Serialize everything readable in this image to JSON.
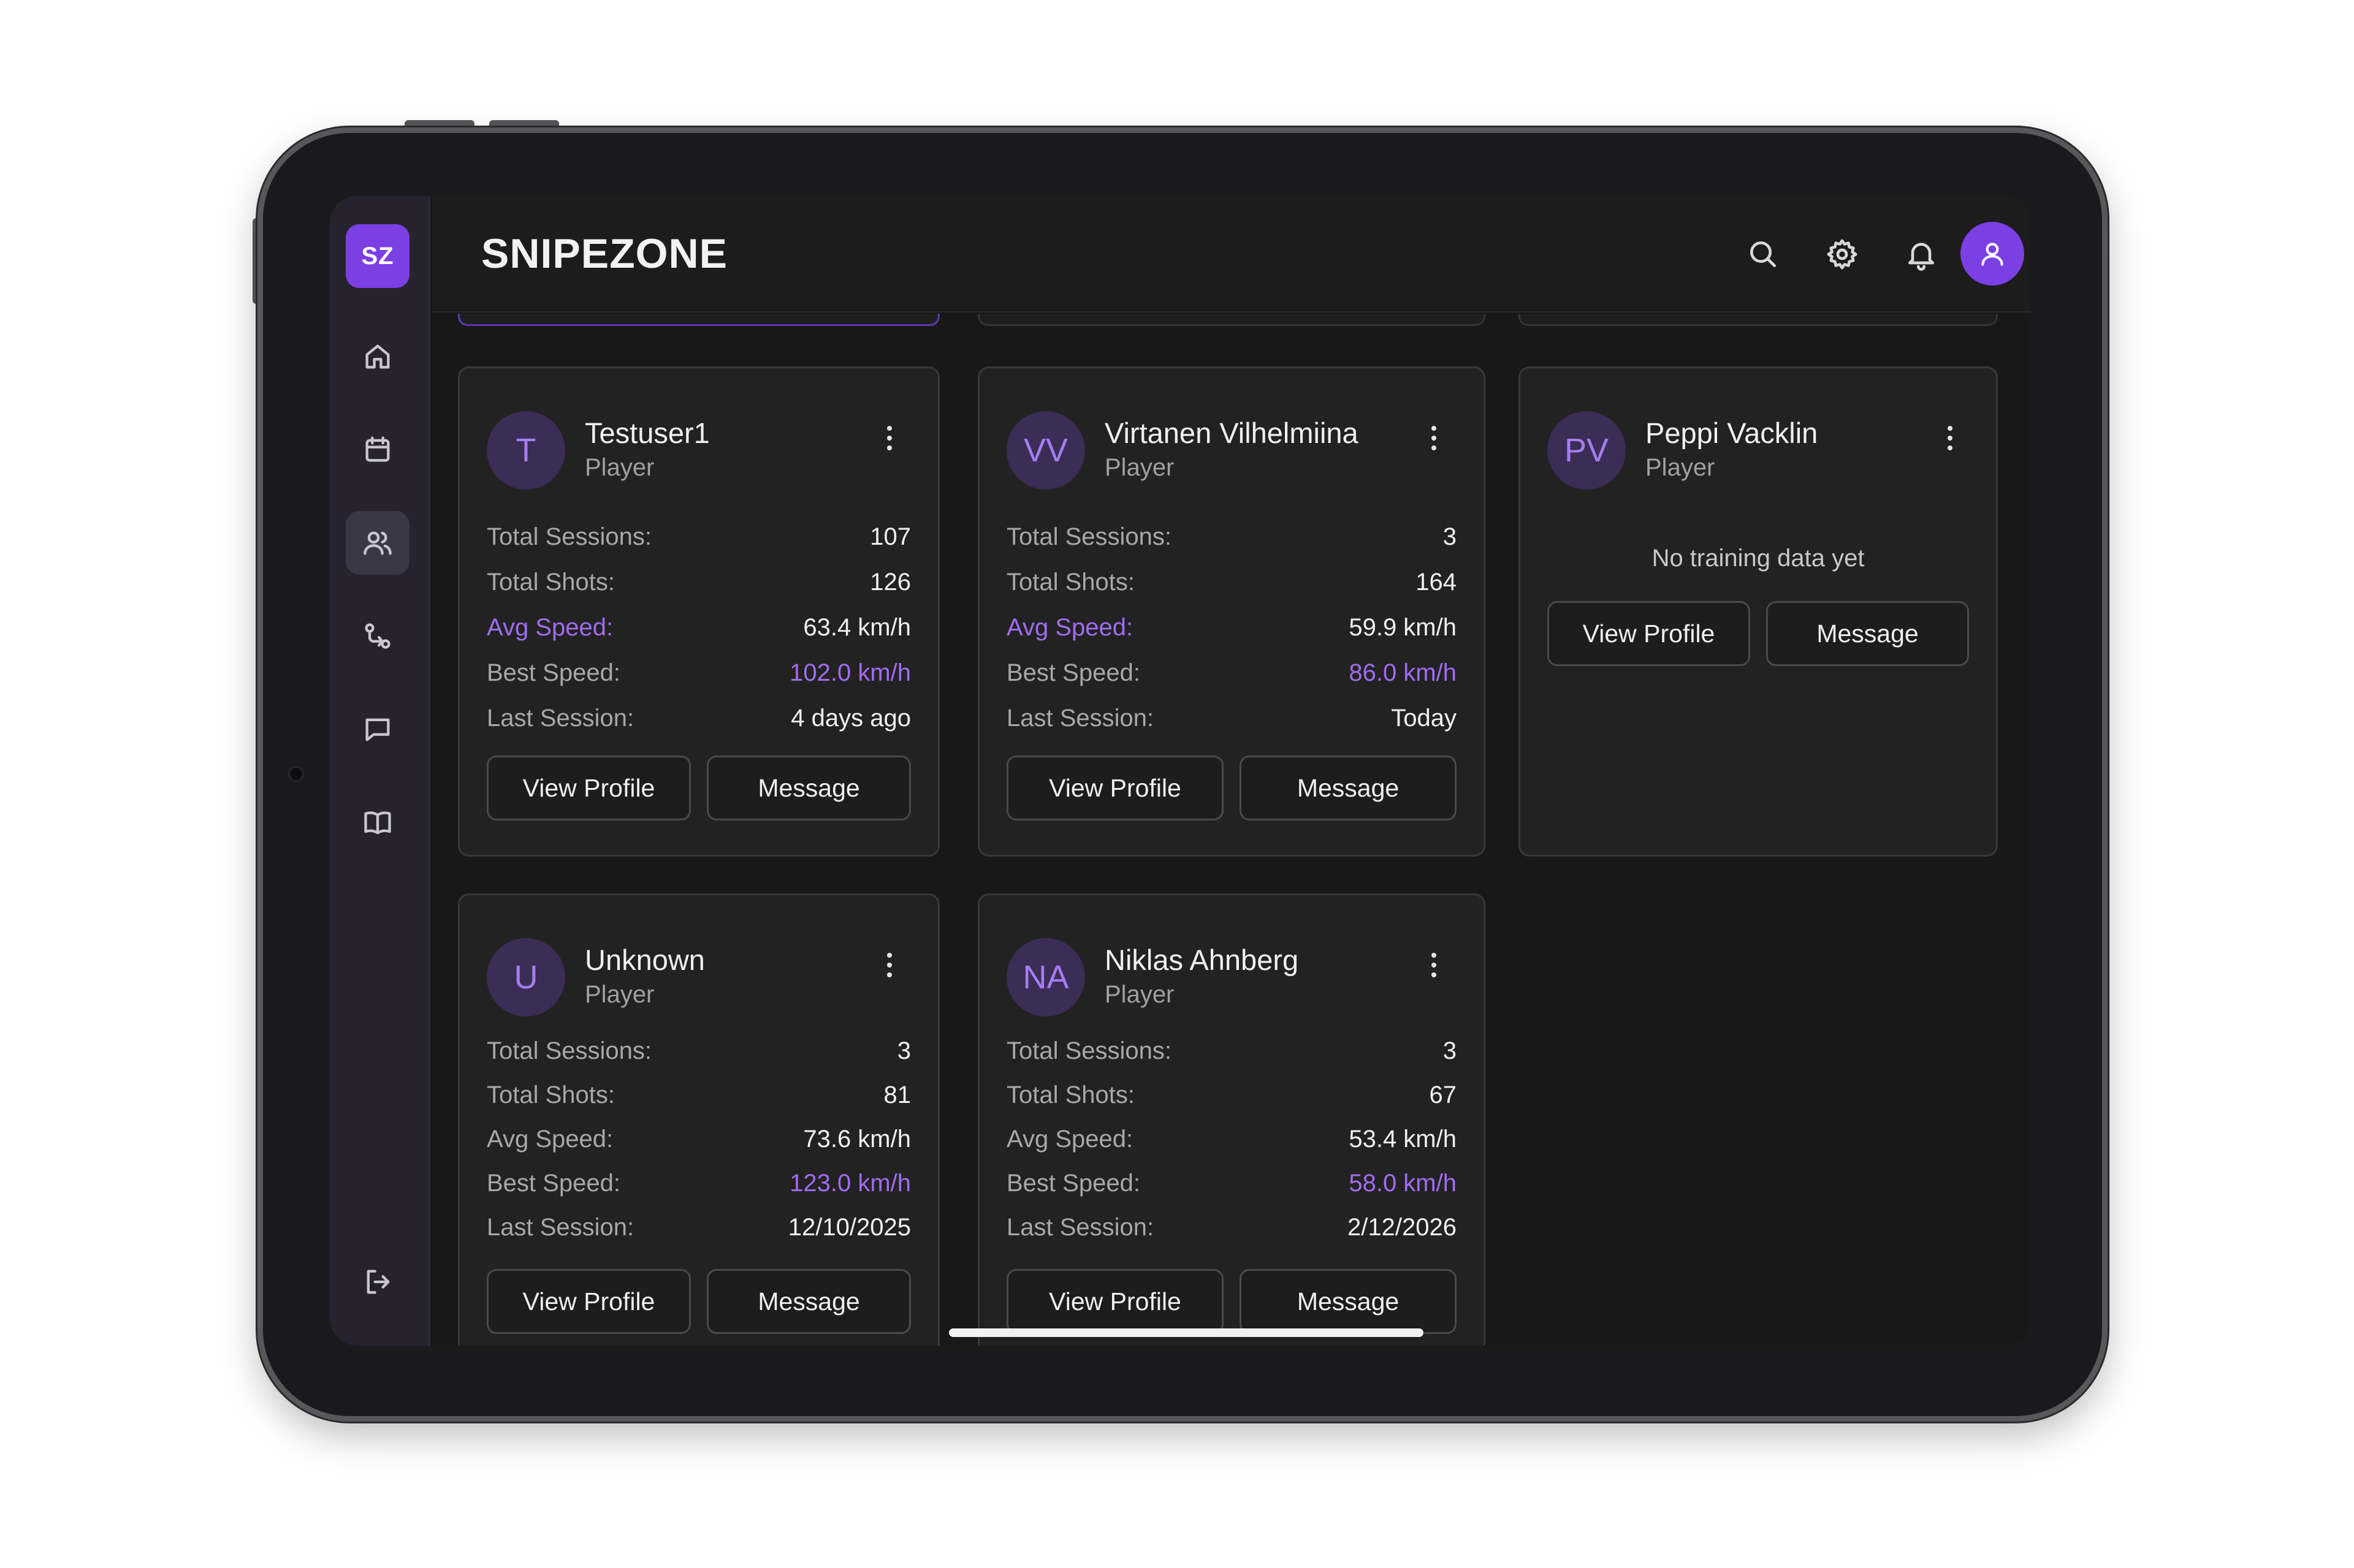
{
  "app": {
    "logo": "SZ",
    "title": "SNIPEZONE"
  },
  "sidebar": {
    "items": [
      {
        "icon": "home-icon",
        "active": false
      },
      {
        "icon": "calendar-icon",
        "active": false
      },
      {
        "icon": "users-icon",
        "active": true
      },
      {
        "icon": "route-icon",
        "active": false
      },
      {
        "icon": "message-icon",
        "active": false
      },
      {
        "icon": "book-icon",
        "active": false
      }
    ],
    "logout_icon": "logout-icon"
  },
  "header": {
    "icons": [
      "search-icon",
      "gear-icon",
      "bell-icon",
      "user-avatar-icon"
    ]
  },
  "labels": {
    "total_sessions": "Total Sessions:",
    "total_shots": "Total Shots:",
    "avg_speed": "Avg Speed:",
    "best_speed": "Best Speed:",
    "last_session": "Last Session:",
    "view_profile": "View Profile",
    "message": "Message",
    "no_data": "No training data yet"
  },
  "players": [
    {
      "initials": "T",
      "name": "Testuser1",
      "role": "Player",
      "total_sessions": "107",
      "total_shots": "126",
      "avg_speed": "63.4 km/h",
      "best_speed": "102.0 km/h",
      "last_session": "4 days ago"
    },
    {
      "initials": "VV",
      "name": "Virtanen Vilhelmiina",
      "role": "Player",
      "total_sessions": "3",
      "total_shots": "164",
      "avg_speed": "59.9 km/h",
      "best_speed": "86.0 km/h",
      "last_session": "Today"
    },
    {
      "initials": "PV",
      "name": "Peppi Vacklin",
      "role": "Player"
    },
    {
      "initials": "U",
      "name": "Unknown",
      "role": "Player",
      "total_sessions": "3",
      "total_shots": "81",
      "avg_speed": "73.6 km/h",
      "best_speed": "123.0 km/h",
      "last_session": "12/10/2025"
    },
    {
      "initials": "NA",
      "name": "Niklas Ahnberg",
      "role": "Player",
      "total_sessions": "3",
      "total_shots": "67",
      "avg_speed": "53.4 km/h",
      "best_speed": "58.0 km/h",
      "last_session": "2/12/2026"
    }
  ],
  "colors": {
    "accent": "#7b3fe4",
    "highlight": "#a16cf0",
    "background": "#181818",
    "card": "#222222",
    "sidebar": "#26232f"
  }
}
